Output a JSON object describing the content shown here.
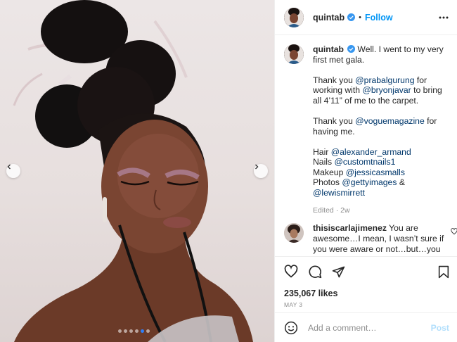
{
  "post": {
    "username": "quintab",
    "separator": "•",
    "follow_label": "Follow",
    "caption": {
      "p1_text": "Well. I went to my very first met gala.",
      "p2_pre": "Thank you ",
      "p2_mention1": "@prabalgurung",
      "p2_mid1": " for working with ",
      "p2_mention2": "@bryonjavar",
      "p2_post": " to bring all 4’11” of me to the carpet.",
      "p3_pre": "Thank you ",
      "p3_mention": "@voguemagazine",
      "p3_post": " for having me.",
      "credits": [
        {
          "role": "Hair ",
          "handle": "@alexander_armand"
        },
        {
          "role": "Nails ",
          "handle": "@customtnails1"
        },
        {
          "role": "Makeup ",
          "handle": "@jessicasmalls"
        },
        {
          "role": "Photos ",
          "handle": "@gettyimages",
          "suffix": " &"
        },
        {
          "role": "",
          "handle": "@lewismirrett"
        }
      ],
      "edited": "Edited · 2w"
    },
    "comment": {
      "username": "thisiscarlajimenez",
      "text": "You are awesome…I mean, I wasn’t sure if you were aware or not…but…you"
    },
    "likes": "235,067 likes",
    "date": "MAY 3",
    "add_comment_placeholder": "Add a comment…",
    "post_label": "Post"
  },
  "carousel": {
    "dot_count": 6,
    "active_index": 4
  },
  "colors": {
    "link": "#00376b",
    "accent": "#0095f6",
    "verified": "#3897f0",
    "muted": "#8e8e8e"
  },
  "icons": [
    "chevron-left-icon",
    "chevron-right-icon",
    "verified-badge-icon",
    "more-options-icon",
    "heart-icon",
    "comment-icon",
    "share-icon",
    "bookmark-icon",
    "emoji-icon"
  ]
}
